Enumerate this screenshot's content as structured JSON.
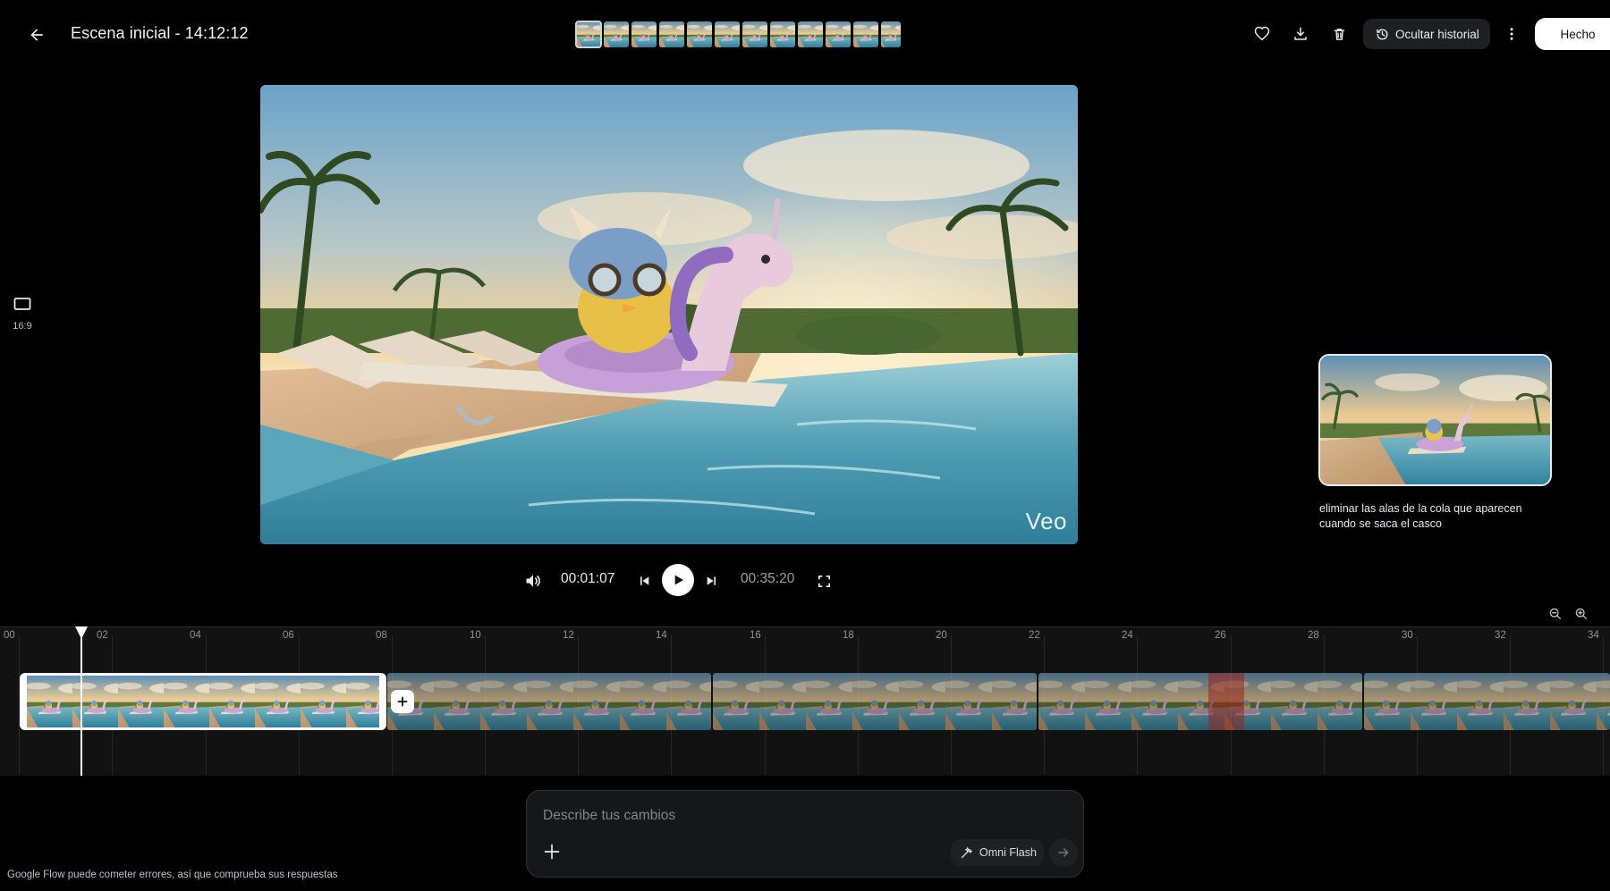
{
  "header": {
    "title": "Escena inicial - 14:12:12",
    "hide_history_label": "Ocultar historial",
    "done_label": "Hecho",
    "thumbnail_count": 12
  },
  "aspect": {
    "label": "16:9"
  },
  "player": {
    "watermark": "Veo",
    "current_time": "00:01:07",
    "total_time": "00:35:20"
  },
  "history": {
    "prompt_text": "eliminar las alas de la cola que aparecen cuando se saca el casco"
  },
  "timeline": {
    "ticks": [
      "00",
      "02",
      "04",
      "06",
      "08",
      "10",
      "12",
      "14",
      "16",
      "18",
      "20",
      "22",
      "24",
      "26",
      "28",
      "30",
      "32",
      "34"
    ],
    "clip_count": 5
  },
  "prompt": {
    "placeholder": "Describe tus cambios",
    "model_label": "Omni Flash"
  },
  "footer": {
    "disclaimer": "Google Flow puede cometer errores, así que comprueba sus respuestas"
  },
  "colors": {
    "background": "#000000",
    "timeline_bg": "#121212",
    "accent_white": "#ffffff"
  }
}
